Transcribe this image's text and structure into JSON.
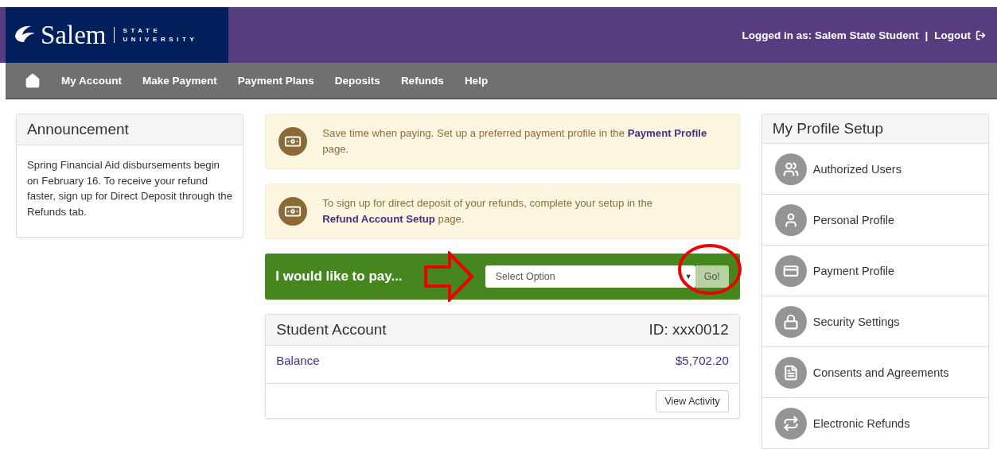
{
  "header": {
    "logo": {
      "name": "Salem",
      "line1": "STATE",
      "line2": "UNIVERSITY"
    },
    "logged_in": "Logged in as: Salem State Student",
    "separator": "|",
    "logout": "Logout"
  },
  "nav": [
    {
      "label": "My Account"
    },
    {
      "label": "Make Payment"
    },
    {
      "label": "Payment Plans"
    },
    {
      "label": "Deposits"
    },
    {
      "label": "Refunds"
    },
    {
      "label": "Help"
    }
  ],
  "announcement": {
    "title": "Announcement",
    "body": "Spring Financial Aid disbursements begin on February 16. To receive your refund faster, sign up for Direct Deposit through the Refunds tab."
  },
  "notices": [
    {
      "before": "Save time when paying. Set up a preferred payment profile in the ",
      "link": "Payment Profile",
      "after": " page."
    },
    {
      "before": "To sign up for direct deposit of your refunds, complete your setup in the ",
      "link": "Refund Account Setup",
      "after": " page."
    }
  ],
  "pay": {
    "label": "I would like to pay...",
    "placeholder": "Select Option",
    "caret": "▼",
    "button": "Go!"
  },
  "account": {
    "title": "Student Account",
    "id": "ID: xxx0012",
    "balance_label": "Balance",
    "balance": "$5,702.20",
    "button": "View Activity"
  },
  "profile": {
    "title": "My Profile Setup",
    "items": [
      {
        "label": "Authorized Users"
      },
      {
        "label": "Personal Profile"
      },
      {
        "label": "Payment Profile"
      },
      {
        "label": "Security Settings"
      },
      {
        "label": "Consents and Agreements"
      },
      {
        "label": "Electronic Refunds"
      }
    ]
  }
}
